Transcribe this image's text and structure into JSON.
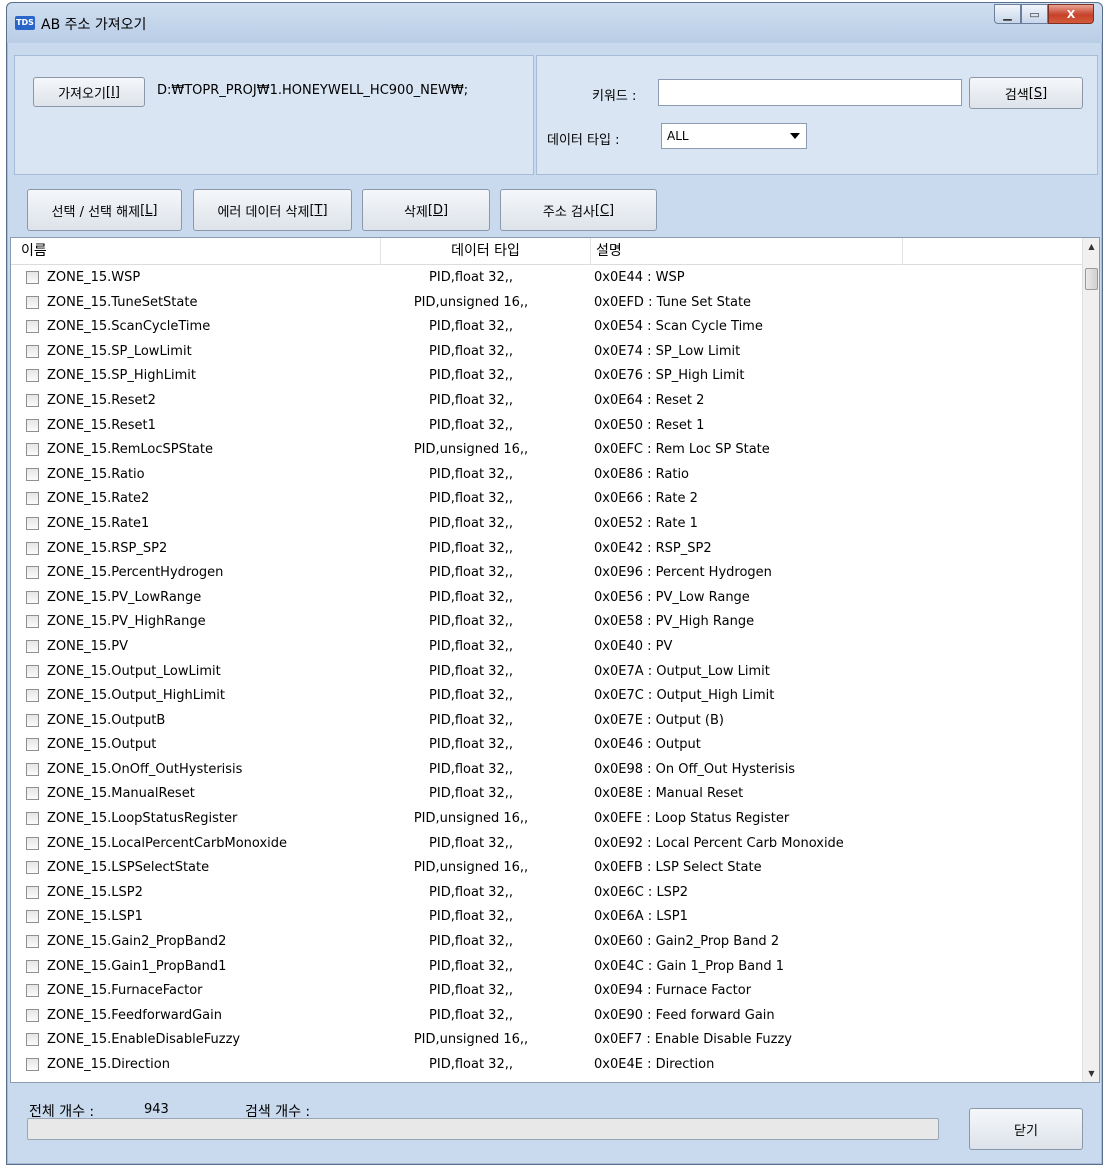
{
  "window": {
    "icon_text": "TDS",
    "title": "AB 주소 가져오기",
    "min_symbol": "▁",
    "max_symbol": "▭",
    "close_symbol": "X"
  },
  "toolbar": {
    "import_label": "가져오기[I]",
    "path_value": "D:₩TOPR_PROJ₩1.HONEYWELL_HC900_NEW₩;",
    "keyword_label": "키워드 :",
    "keyword_value": "",
    "search_label": "검색[S]",
    "datatype_label": "데이터 타입 :",
    "datatype_value": "ALL"
  },
  "actions": {
    "select_toggle": "선택 / 선택 해제[L]",
    "delete_error": "에러 데이터 삭제[T]",
    "delete": "삭제[D]",
    "check_address": "주소 검사[C]"
  },
  "table": {
    "headers": {
      "name": "이름",
      "type": "데이터 타입",
      "desc": "설명"
    },
    "rows": [
      {
        "name": "ZONE_15.WSP",
        "type": "PID,float 32,,",
        "desc": "0x0E44 : WSP"
      },
      {
        "name": "ZONE_15.TuneSetState",
        "type": "PID,unsigned 16,,",
        "desc": "0x0EFD : Tune Set State"
      },
      {
        "name": "ZONE_15.ScanCycleTime",
        "type": "PID,float 32,,",
        "desc": "0x0E54 : Scan Cycle Time"
      },
      {
        "name": "ZONE_15.SP_LowLimit",
        "type": "PID,float 32,,",
        "desc": "0x0E74 : SP_Low Limit"
      },
      {
        "name": "ZONE_15.SP_HighLimit",
        "type": "PID,float 32,,",
        "desc": "0x0E76 : SP_High Limit"
      },
      {
        "name": "ZONE_15.Reset2",
        "type": "PID,float 32,,",
        "desc": "0x0E64 : Reset 2"
      },
      {
        "name": "ZONE_15.Reset1",
        "type": "PID,float 32,,",
        "desc": "0x0E50 : Reset 1"
      },
      {
        "name": "ZONE_15.RemLocSPState",
        "type": "PID,unsigned 16,,",
        "desc": "0x0EFC : Rem Loc SP State"
      },
      {
        "name": "ZONE_15.Ratio",
        "type": "PID,float 32,,",
        "desc": "0x0E86 : Ratio"
      },
      {
        "name": "ZONE_15.Rate2",
        "type": "PID,float 32,,",
        "desc": "0x0E66 : Rate 2"
      },
      {
        "name": "ZONE_15.Rate1",
        "type": "PID,float 32,,",
        "desc": "0x0E52 : Rate 1"
      },
      {
        "name": "ZONE_15.RSP_SP2",
        "type": "PID,float 32,,",
        "desc": "0x0E42 : RSP_SP2"
      },
      {
        "name": "ZONE_15.PercentHydrogen",
        "type": "PID,float 32,,",
        "desc": "0x0E96 : Percent Hydrogen"
      },
      {
        "name": "ZONE_15.PV_LowRange",
        "type": "PID,float 32,,",
        "desc": "0x0E56 : PV_Low Range"
      },
      {
        "name": "ZONE_15.PV_HighRange",
        "type": "PID,float 32,,",
        "desc": "0x0E58 : PV_High Range"
      },
      {
        "name": "ZONE_15.PV",
        "type": "PID,float 32,,",
        "desc": "0x0E40 : PV"
      },
      {
        "name": "ZONE_15.Output_LowLimit",
        "type": "PID,float 32,,",
        "desc": "0x0E7A : Output_Low Limit"
      },
      {
        "name": "ZONE_15.Output_HighLimit",
        "type": "PID,float 32,,",
        "desc": "0x0E7C : Output_High Limit"
      },
      {
        "name": "ZONE_15.OutputB",
        "type": "PID,float 32,,",
        "desc": "0x0E7E : Output (B)"
      },
      {
        "name": "ZONE_15.Output",
        "type": "PID,float 32,,",
        "desc": "0x0E46 : Output"
      },
      {
        "name": "ZONE_15.OnOff_OutHysterisis",
        "type": "PID,float 32,,",
        "desc": "0x0E98 : On Off_Out Hysterisis"
      },
      {
        "name": "ZONE_15.ManualReset",
        "type": "PID,float 32,,",
        "desc": "0x0E8E : Manual Reset"
      },
      {
        "name": "ZONE_15.LoopStatusRegister",
        "type": "PID,unsigned 16,,",
        "desc": "0x0EFE : Loop Status Register"
      },
      {
        "name": "ZONE_15.LocalPercentCarbMonoxide",
        "type": "PID,float 32,,",
        "desc": "0x0E92 : Local Percent Carb Monoxide"
      },
      {
        "name": "ZONE_15.LSPSelectState",
        "type": "PID,unsigned 16,,",
        "desc": "0x0EFB : LSP Select State"
      },
      {
        "name": "ZONE_15.LSP2",
        "type": "PID,float 32,,",
        "desc": "0x0E6C : LSP2"
      },
      {
        "name": "ZONE_15.LSP1",
        "type": "PID,float 32,,",
        "desc": "0x0E6A : LSP1"
      },
      {
        "name": "ZONE_15.Gain2_PropBand2",
        "type": "PID,float 32,,",
        "desc": "0x0E60 : Gain2_Prop Band 2"
      },
      {
        "name": "ZONE_15.Gain1_PropBand1",
        "type": "PID,float 32,,",
        "desc": "0x0E4C : Gain 1_Prop Band 1"
      },
      {
        "name": "ZONE_15.FurnaceFactor",
        "type": "PID,float 32,,",
        "desc": "0x0E94 : Furnace Factor"
      },
      {
        "name": "ZONE_15.FeedforwardGain",
        "type": "PID,float 32,,",
        "desc": "0x0E90 : Feed forward Gain"
      },
      {
        "name": "ZONE_15.EnableDisableFuzzy",
        "type": "PID,unsigned 16,,",
        "desc": "0x0EF7 : Enable Disable Fuzzy"
      },
      {
        "name": "ZONE_15.Direction",
        "type": "PID,float 32,,",
        "desc": "0x0E4E : Direction"
      }
    ]
  },
  "footer": {
    "total_label": "전체 개수 :",
    "total_value": "943",
    "search_count_label": "검색 개수 :",
    "search_count_value": "",
    "progress": 0,
    "close_label": "닫기"
  },
  "colors": {
    "window_bg": "#c9daee",
    "close_button": "#c7412a"
  }
}
